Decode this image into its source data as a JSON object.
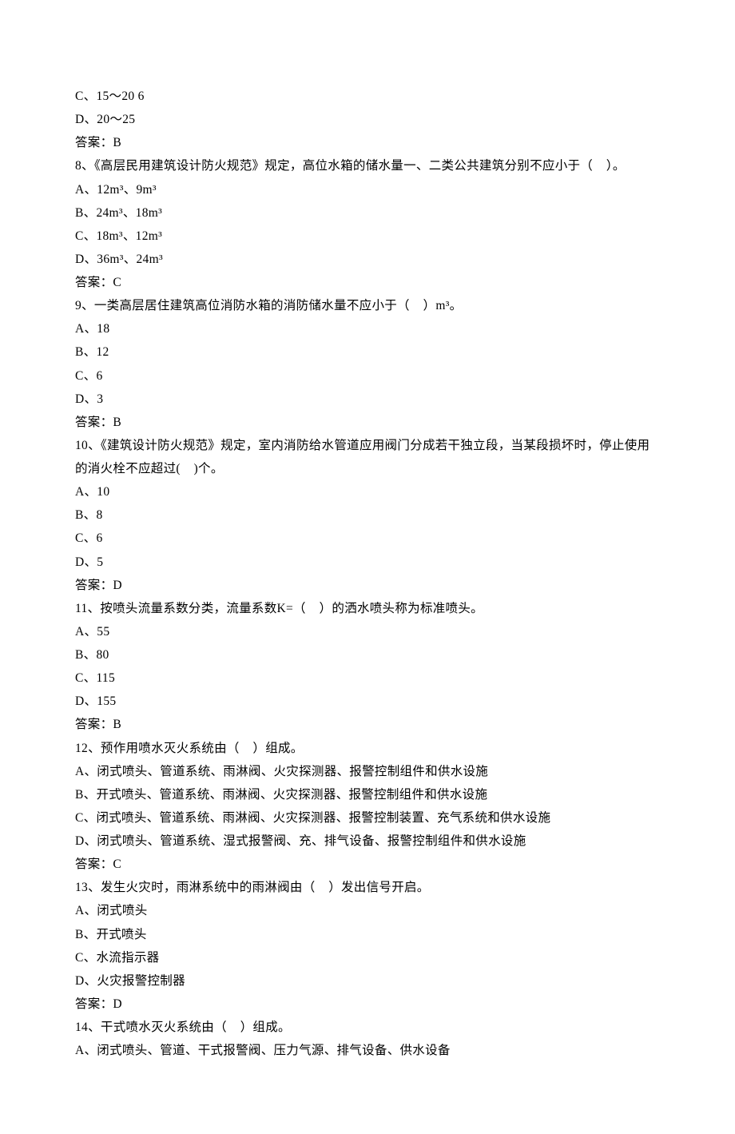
{
  "fragment": {
    "top_options": [
      "C、15～20 6",
      "D、20～25"
    ],
    "top_answer": "答案：B"
  },
  "questions": [
    {
      "stem": "8、《高层民用建筑设计防火规范》规定，高位水箱的储水量一、二类公共建筑分别不应小于（    ）。",
      "options": [
        "A、12m³、9m³",
        "B、24m³、18m³",
        "C、18m³、12m³",
        "D、36m³、24m³"
      ],
      "answer": "答案：C"
    },
    {
      "stem": "9、一类高层居住建筑高位消防水箱的消防储水量不应小于（    ）m³。",
      "options": [
        "A、18",
        "B、12",
        "C、6",
        "D、3"
      ],
      "answer": "答案：B"
    },
    {
      "stem": "10、《建筑设计防火规范》规定，室内消防给水管道应用阀门分成若干独立段，当某段损坏时，停止使用的消火栓不应超过(    )个。",
      "options": [
        "A、10",
        "B、8",
        "C、6",
        "D、5"
      ],
      "answer": "答案：D"
    },
    {
      "stem": "11、按喷头流量系数分类，流量系数K=（    ）的洒水喷头称为标准喷头。",
      "options": [
        "A、55",
        "B、80",
        "C、115",
        "D、155"
      ],
      "answer": "答案：B"
    },
    {
      "stem": "12、预作用喷水灭火系统由（    ）组成。",
      "options": [
        "A、闭式喷头、管道系统、雨淋阀、火灾探测器、报警控制组件和供水设施",
        "B、开式喷头、管道系统、雨淋阀、火灾探测器、报警控制组件和供水设施",
        "C、闭式喷头、管道系统、雨淋阀、火灾探测器、报警控制装置、充气系统和供水设施",
        "D、闭式喷头、管道系统、湿式报警阀、充、排气设备、报警控制组件和供水设施"
      ],
      "answer": "答案：C"
    },
    {
      "stem": "13、发生火灾时，雨淋系统中的雨淋阀由（    ）发出信号开启。",
      "options": [
        "A、闭式喷头",
        "B、开式喷头",
        "C、水流指示器",
        "D、火灾报警控制器"
      ],
      "answer": "答案：D"
    },
    {
      "stem": "14、干式喷水灭火系统由（    ）组成。",
      "options": [
        "A、闭式喷头、管道、干式报警阀、压力气源、排气设备、供水设备"
      ],
      "answer": ""
    }
  ]
}
